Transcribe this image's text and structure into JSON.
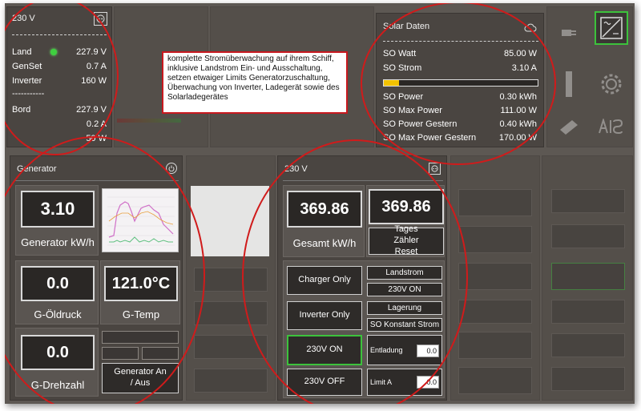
{
  "power_panel": {
    "title": "230 V",
    "rows": [
      {
        "label": "Land",
        "value": "227.9 V"
      },
      {
        "label": "GenSet",
        "value": "0.7 A"
      },
      {
        "label": "Inverter",
        "value": "160 W"
      }
    ],
    "divider": "-----------",
    "bord_label": "Bord",
    "bord_values": [
      "227.9 V",
      "0.2 A",
      "50 W"
    ]
  },
  "callout": {
    "text": "komplette Stromüberwachung auf ihrem Schiff, inklusive Landstrom Ein- und Ausschaltung, setzen etwaiger Limits Generatorzuschaltung, Überwachung von Inverter, Ladegerät sowie des Solarladegerätes"
  },
  "solar": {
    "title": "Solar Daten",
    "rows_top": [
      {
        "label": "SO Watt",
        "value": "85.00 W"
      },
      {
        "label": "SO Strom",
        "value": "3.10 A"
      }
    ],
    "progress_fraction": 0.1,
    "rows_bottom": [
      {
        "label": "SO Power",
        "value": "0.30 kWh"
      },
      {
        "label": "SO Max Power",
        "value": "111.00 W"
      },
      {
        "label": "SO Power Gestern",
        "value": "0.40 kWh"
      },
      {
        "label": "SO Max Power Gestern",
        "value": "170.00 W"
      }
    ]
  },
  "generator": {
    "title": "Generator",
    "kwh_value": "3.10",
    "kwh_label": "Generator kW/h",
    "oil_value": "0.0",
    "oil_label": "G-Öldruck",
    "temp_value": "121.0°C",
    "temp_label": "G-Temp",
    "rpm_value": "0.0",
    "rpm_label": "G-Drehzahl",
    "toggle_label": "Generator An / Aus"
  },
  "ac": {
    "title": "230 V",
    "total_value": "369.86",
    "total_label": "Gesamt kW/h",
    "day_value": "369.86",
    "reset_label": "Tages Zähler Reset",
    "charger_only": "Charger Only",
    "inverter_only": "Inverter Only",
    "on_label": "230V ON",
    "off_label": "230V OFF",
    "landstrom": "Landstrom",
    "status_230v": "230V ON",
    "lagerung": "Lagerung",
    "so_konstant": "SO Konstant Strom",
    "entladung_label": "Entladung",
    "entladung_value": "0.0",
    "limit_label": "Limit A",
    "limit_value": "0.0"
  },
  "colors": {
    "highlight": "#d01b1b",
    "active_green": "#3cc23c",
    "progress": "#f2c200"
  }
}
